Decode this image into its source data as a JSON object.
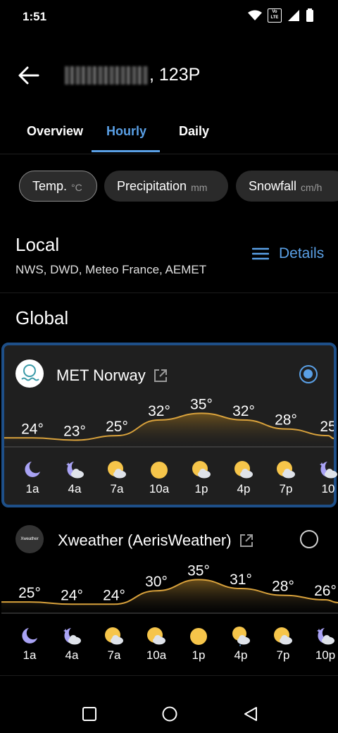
{
  "status": {
    "time": "1:51",
    "volte": "Vo LTE"
  },
  "header": {
    "title_suffix": ", 123P"
  },
  "tabs": [
    {
      "label": "Overview"
    },
    {
      "label": "Hourly"
    },
    {
      "label": "Daily"
    }
  ],
  "chips": [
    {
      "label": "Temp.",
      "unit": "°C"
    },
    {
      "label": "Precipitation",
      "unit": "mm"
    },
    {
      "label": "Snowfall",
      "unit": "cm/h"
    }
  ],
  "local": {
    "heading": "Local",
    "sources": "NWS, DWD, Meteo France, AEMET",
    "details_label": "Details"
  },
  "global": {
    "heading": "Global"
  },
  "colors": {
    "accent": "#5aa0e6",
    "line": "#d9a23c",
    "selected_border": "#1e4f88"
  },
  "providers": [
    {
      "name": "MET Norway",
      "selected": true,
      "logo_icon": "met-norway-logo",
      "chart_data": {
        "type": "area",
        "x": [
          "1a",
          "4a",
          "7a",
          "10a",
          "1p",
          "4p",
          "7p",
          "10"
        ],
        "series": [
          {
            "values": [
              24,
              23,
              25,
              32,
              35,
              32,
              28,
              25
            ]
          }
        ],
        "point_labels": [
          "24°",
          "23°",
          "25°",
          "32°",
          "35°",
          "32°",
          "28°",
          "25"
        ],
        "ylim": [
          20,
          37
        ]
      },
      "icons": [
        "moon-icon",
        "moon-cloud-icon",
        "sun-cloud-icon",
        "sun-icon",
        "sun-cloud-icon",
        "sun-cloud-icon",
        "sun-cloud-icon",
        "moon-cloud-icon"
      ]
    },
    {
      "name": "Xweather (AerisWeather)",
      "selected": false,
      "logo_text": "Xweather",
      "logo_icon": "xweather-logo",
      "chart_data": {
        "type": "area",
        "x": [
          "1a",
          "4a",
          "7a",
          "10a",
          "1p",
          "4p",
          "7p",
          "10p"
        ],
        "series": [
          {
            "values": [
              25,
              24,
              24,
              30,
              35,
              31,
              28,
              26
            ]
          }
        ],
        "point_labels": [
          "25°",
          "24°",
          "24°",
          "30°",
          "35°",
          "31°",
          "28°",
          "26°"
        ],
        "ylim": [
          20,
          37
        ]
      },
      "icons": [
        "moon-icon",
        "moon-cloud-icon",
        "sun-cloud-icon",
        "sun-cloud-icon",
        "sun-icon",
        "sun-rain-cloud-icon",
        "sun-cloud-icon",
        "moon-cloud-icon"
      ]
    }
  ]
}
